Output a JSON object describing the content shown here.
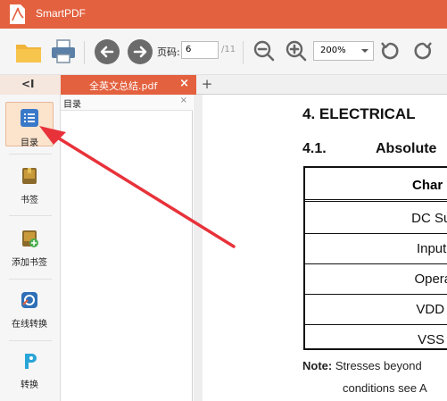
{
  "window": {
    "title": "SmartPDF"
  },
  "toolbar": {
    "page_label": "页码:",
    "page_value": "6",
    "page_total": "/11",
    "zoom_value": "200%"
  },
  "tabs": {
    "active_tab": "全英文总结.pdf",
    "close_glyph": "×",
    "add_glyph": "+"
  },
  "collapse_glyph": "<I",
  "sidebar": {
    "items": [
      {
        "label": "目录",
        "icon": "toc-list-icon",
        "active": true
      },
      {
        "label": "书签",
        "icon": "bookmark-icon"
      },
      {
        "label": "添加书签",
        "icon": "add-bookmark-icon"
      },
      {
        "label": "在线转换",
        "icon": "online-convert-icon"
      },
      {
        "label": "转换",
        "icon": "convert-icon"
      }
    ]
  },
  "toc_panel": {
    "title": "目录",
    "close_glyph": "×"
  },
  "document": {
    "heading1": "4. ELECTRICAL",
    "heading2_num": "4.1.",
    "heading2_title": "Absolute",
    "table_header": "Char",
    "rows": [
      "DC Supp",
      "Input Vo",
      "Operatin",
      "VDD Tot",
      "VSS Tot"
    ],
    "note_label": "Note:",
    "note_text": "Stresses beyond",
    "note_line2": "conditions see A"
  },
  "colors": {
    "accent": "#e3613f",
    "annotation_arrow": "#e8323a"
  }
}
